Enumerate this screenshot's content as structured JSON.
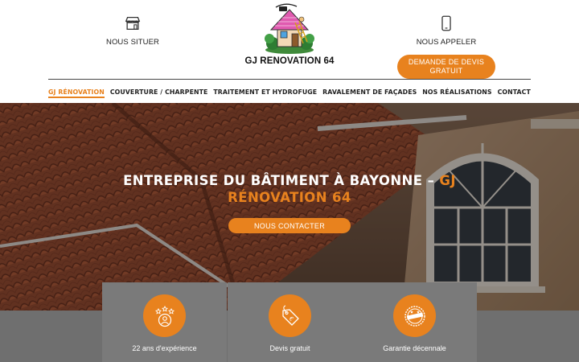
{
  "header": {
    "locate_label": "NOUS SITUER",
    "call_label": "NOUS APPELER",
    "logo_text": "GJ RENOVATION 64",
    "quote_button": "DEMANDE DE DEVIS GRATUIT"
  },
  "nav": {
    "items": [
      {
        "label": "GJ RÉNOVATION",
        "active": true
      },
      {
        "label": "COUVERTURE / CHARPENTE",
        "active": false
      },
      {
        "label": "TRAITEMENT ET HYDROFUGE",
        "active": false
      },
      {
        "label": "RAVALEMENT DE FAÇADES",
        "active": false
      },
      {
        "label": "NOS RÉALISATIONS",
        "active": false
      },
      {
        "label": "CONTACT",
        "active": false
      }
    ]
  },
  "hero": {
    "title_main": "ENTREPRISE DU BÂTIMENT À BAYONNE – ",
    "title_accent": "GJ RÉNOVATION 64",
    "button": "NOUS CONTACTER"
  },
  "features": [
    {
      "label": "22 ans d'expérience",
      "icon": "stars-person-icon"
    },
    {
      "label": "Devis gratuit",
      "icon": "price-tag-icon"
    },
    {
      "label": "Garantie décennale",
      "icon": "guarantee-seal-icon"
    }
  ],
  "colors": {
    "accent": "#e8821e",
    "nav_text": "#222222",
    "feature_card": "#7a7a7a",
    "feature_band": "#6f6f6f"
  }
}
